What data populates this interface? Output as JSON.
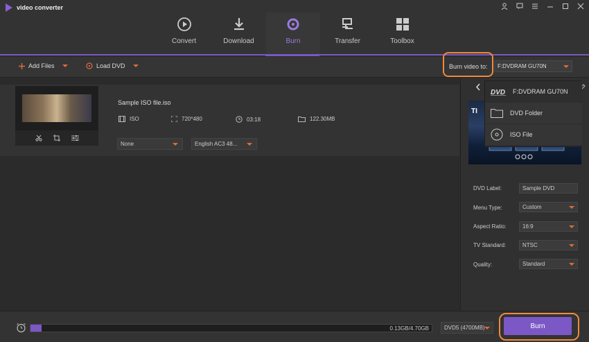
{
  "app": {
    "title": "video converter"
  },
  "tabs": [
    {
      "label": "Convert",
      "icon": "convert-icon"
    },
    {
      "label": "Download",
      "icon": "download-icon"
    },
    {
      "label": "Burn",
      "icon": "burn-icon",
      "active": true
    },
    {
      "label": "Transfer",
      "icon": "transfer-icon"
    },
    {
      "label": "Toolbox",
      "icon": "toolbox-icon"
    }
  ],
  "toolbar": {
    "add_files": "Add Files",
    "load_dvd": "Load DVD",
    "burn_to_label": "Burn video to:",
    "burn_to_value": "F:DVDRAM GU70N"
  },
  "file": {
    "name": "Sample ISO file.iso",
    "format": "ISO",
    "resolution": "720*480",
    "duration": "03:18",
    "size": "122.30MB",
    "subtitle": "None",
    "audio": "English AC3 48..."
  },
  "dvd_menu": {
    "items": [
      {
        "label": "F:DVDRAM GU70N",
        "icon": "dvd-icon"
      },
      {
        "label": "DVD Folder",
        "icon": "folder-icon"
      },
      {
        "label": "ISO File",
        "icon": "disc-icon"
      }
    ]
  },
  "settings": [
    {
      "label": "DVD Label:",
      "value": "Sample DVD"
    },
    {
      "label": "Menu Type:",
      "value": "Custom"
    },
    {
      "label": "Aspect Ratio:",
      "value": "16:9"
    },
    {
      "label": "TV Standard:",
      "value": "NTSC"
    },
    {
      "label": "Quality:",
      "value": "Standard"
    }
  ],
  "footer": {
    "progress_text": "0.13GB/4.70GB",
    "progress_fraction": 0.028,
    "dvd_size": "DVD5 (4700MB)",
    "burn_label": "Burn"
  },
  "colors": {
    "accent": "#7b58c6",
    "highlight": "#f08a3c"
  }
}
